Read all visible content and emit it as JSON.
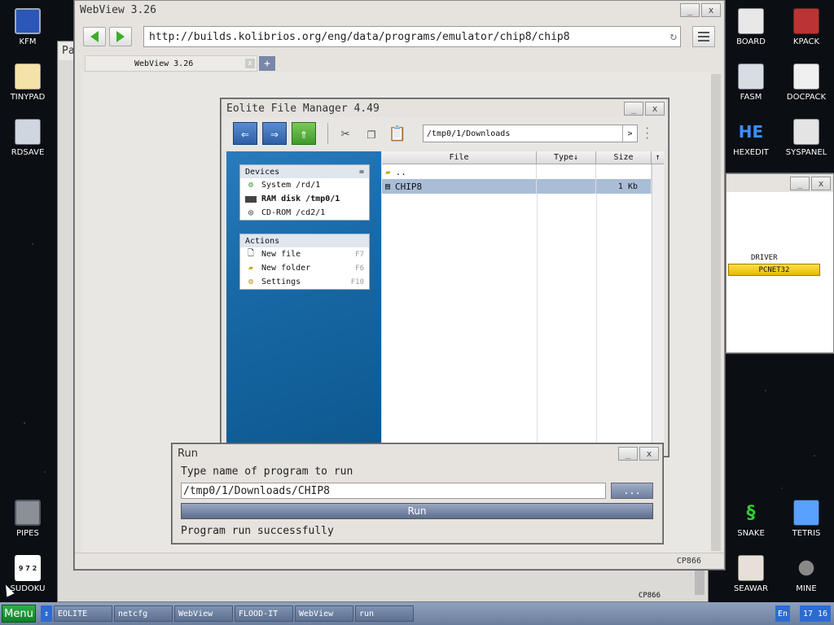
{
  "desktop": {
    "icons_left": [
      {
        "label": "KFM",
        "icon": "floppy-icon"
      },
      {
        "label": "TINYPAD",
        "icon": "notepad-icon"
      },
      {
        "label": "RDSAVE",
        "icon": "save-disk-icon"
      },
      {
        "label": "PIPES",
        "icon": "pipes-game-icon"
      },
      {
        "label": "SUDOKU",
        "icon": "sudoku-icon"
      }
    ],
    "icons_right": [
      {
        "label": "BOARD",
        "icon": "board-icon"
      },
      {
        "label": "KPACK",
        "icon": "kpack-icon"
      },
      {
        "label": "FASM",
        "icon": "fasm-icon"
      },
      {
        "label": "DOCPACK",
        "icon": "docpack-icon"
      },
      {
        "label": "HEXEDIT",
        "icon": "hexedit-icon"
      },
      {
        "label": "SYSPANEL",
        "icon": "syspanel-icon"
      },
      {
        "label": "SNAKE",
        "icon": "snake-icon"
      },
      {
        "label": "TETRIS",
        "icon": "tetris-icon"
      },
      {
        "label": "SEAWAR",
        "icon": "seawar-icon"
      },
      {
        "label": "MINE",
        "icon": "mine-icon"
      }
    ],
    "sudoku_glyph": "9 7 2",
    "hexedit_glyph": "HE"
  },
  "background_window": {
    "title_fragment": "Pa",
    "status": "CP866"
  },
  "driver_window": {
    "label": "DRIVER",
    "badge": "PCNET32"
  },
  "webview": {
    "title": "WebView 3.26",
    "url": "http://builds.kolibrios.org/eng/data/programs/emulator/chip8/chip8",
    "tab_label": "WebView 3.26",
    "tab_add": "+",
    "status": "CP866",
    "min": "_",
    "close": "x"
  },
  "eolite": {
    "title": "Eolite File Manager 4.49",
    "path": "/tmp0/1/Downloads",
    "go": ">",
    "devices_header": "Devices",
    "devices_menu": "=",
    "devices": [
      {
        "label": "System /rd/1",
        "icon": "system-drive-icon"
      },
      {
        "label": "RAM disk /tmp0/1",
        "icon": "ram-disk-icon"
      },
      {
        "label": "CD-ROM /cd2/1",
        "icon": "cdrom-icon"
      }
    ],
    "actions_header": "Actions",
    "actions": [
      {
        "label": "New file",
        "key": "F7",
        "icon": "new-file-icon"
      },
      {
        "label": "New folder",
        "key": "F6",
        "icon": "new-folder-icon"
      },
      {
        "label": "Settings",
        "key": "F10",
        "icon": "settings-icon"
      }
    ],
    "columns": {
      "file": "File",
      "type": "Type↓",
      "size": "Size"
    },
    "files": [
      {
        "name": "..",
        "type": "",
        "size": "",
        "icon": "up-folder-icon",
        "selected": false
      },
      {
        "name": "CHIP8",
        "type": "",
        "size": "1 Kb",
        "icon": "file-icon",
        "selected": true
      }
    ]
  },
  "run": {
    "title": "Run",
    "prompt": "Type name of program to run",
    "value": "/tmp0/1/Downloads/CHIP8",
    "browse": "...",
    "run_button": "Run",
    "status": "Program run successfully"
  },
  "taskbar": {
    "menu": "Menu",
    "arrow": "↕",
    "items": [
      "EOLITE",
      "netcfg",
      "WebView",
      "FLOOD-IT",
      "WebView",
      "run"
    ],
    "lang": "En",
    "clock": "17 16"
  }
}
